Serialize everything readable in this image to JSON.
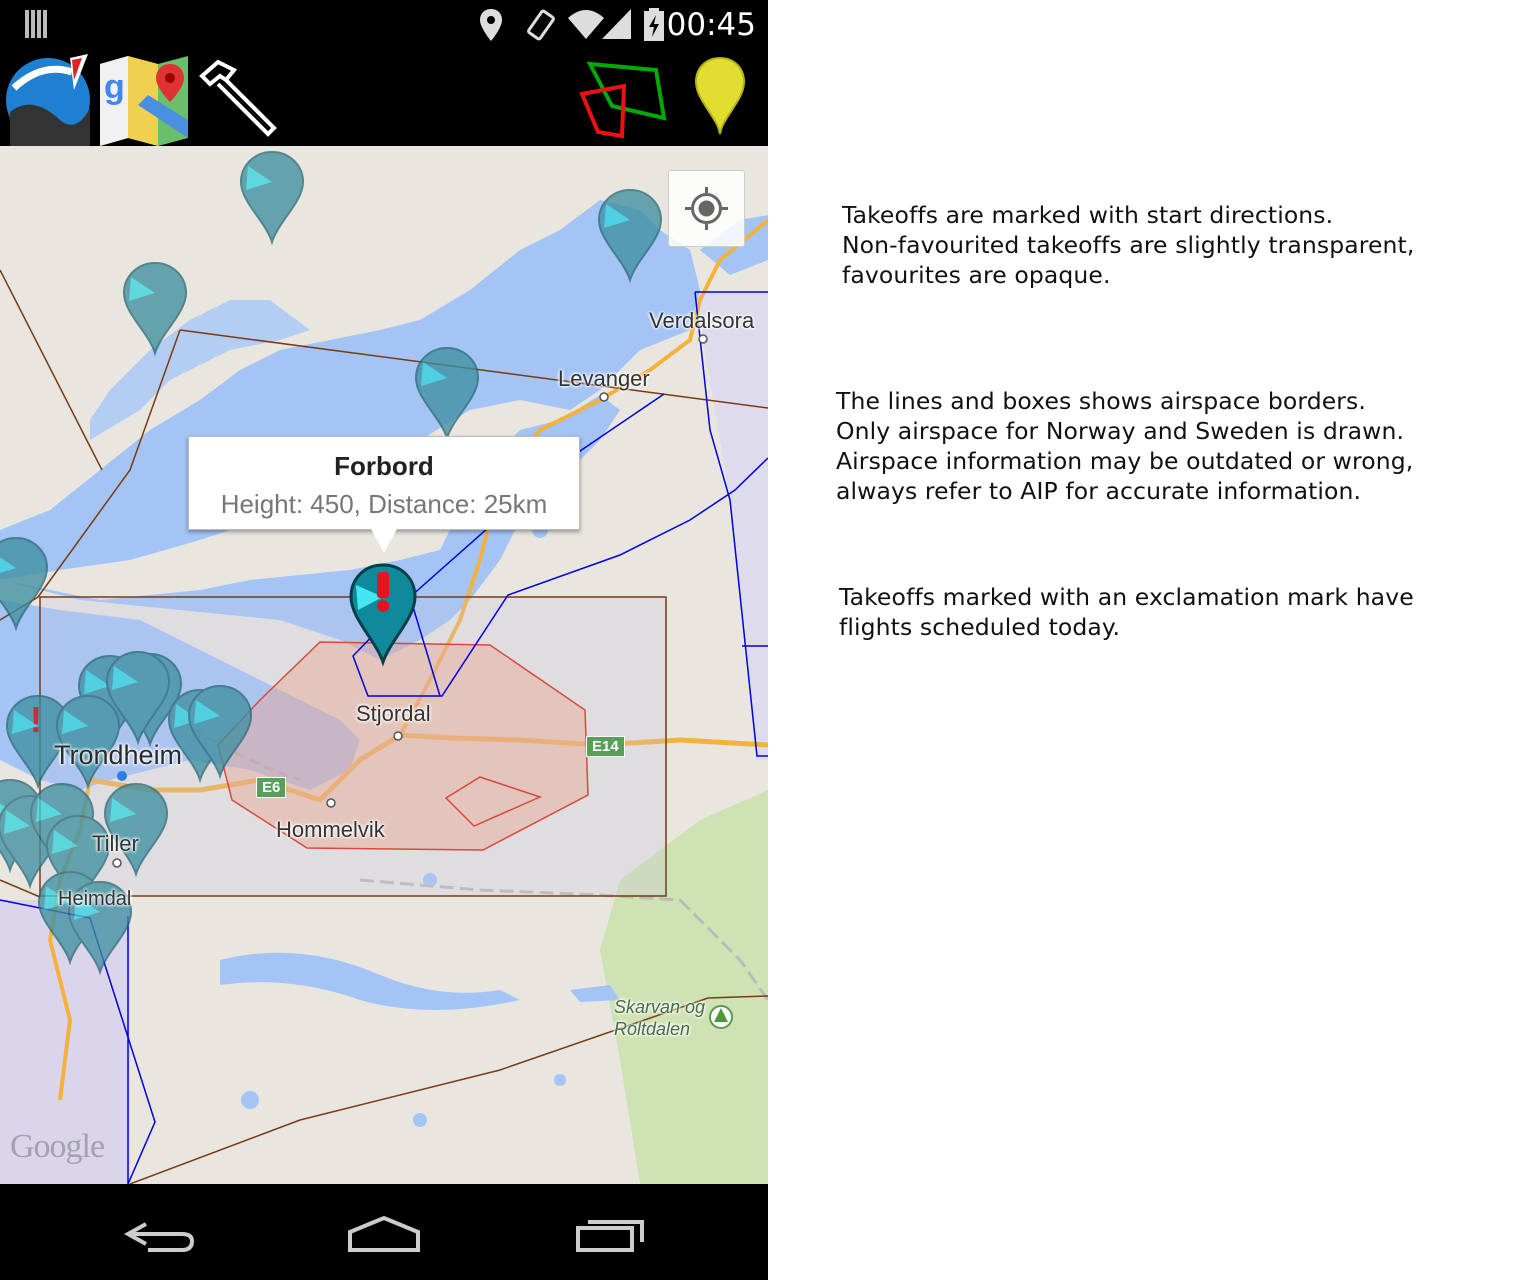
{
  "status_bar": {
    "time": "00:45",
    "icons": [
      "notification-bars-icon",
      "location-icon",
      "rotate-icon",
      "wifi-icon",
      "signal-icon",
      "battery-charging-icon"
    ]
  },
  "action_bar": {
    "icons": [
      "app-logo-paraglider-icon",
      "google-maps-icon",
      "tools-hammer-icon",
      "airspace-polygons-icon",
      "yellow-pin-icon"
    ]
  },
  "map": {
    "places": {
      "verdalsora": "Verdalsora",
      "levanger": "Levanger",
      "stjordal": "Stjordal",
      "trondheim": "Trondheim",
      "hommelvik": "Hommelvik",
      "tiller": "Tiller",
      "heimdal": "Heimdal",
      "skarvan": "Skarvan og\nRoltdalen"
    },
    "road_shields": {
      "e14": "E14",
      "e6": "E6"
    },
    "popup": {
      "title": "Forbord",
      "subtitle": "Height: 450, Distance: 25km"
    },
    "attribution": "Google"
  },
  "nav_bar": {
    "icons": [
      "back-icon",
      "home-icon",
      "recents-icon"
    ]
  },
  "help_text": {
    "takeoffs": "Takeoffs are marked with start directions.\nNon-favourited takeoffs are slightly transparent,\nfavourites are opaque.",
    "airspace": "The lines and boxes shows airspace borders.\nOnly airspace for Norway and Sweden is drawn.\nAirspace information may be outdated or wrong,\nalways refer to AIP for accurate information.",
    "flights": "Takeoffs marked with an exclamation mark have\nflights scheduled today."
  },
  "colors": {
    "water": "#a3c4f5",
    "land": "#e9e6df",
    "marker": "#4fb8c9",
    "airspace_brown": "#7a3a12",
    "airspace_blue": "#0000e0",
    "airspace_red": "#e02000",
    "highway": "#f4b23d"
  }
}
